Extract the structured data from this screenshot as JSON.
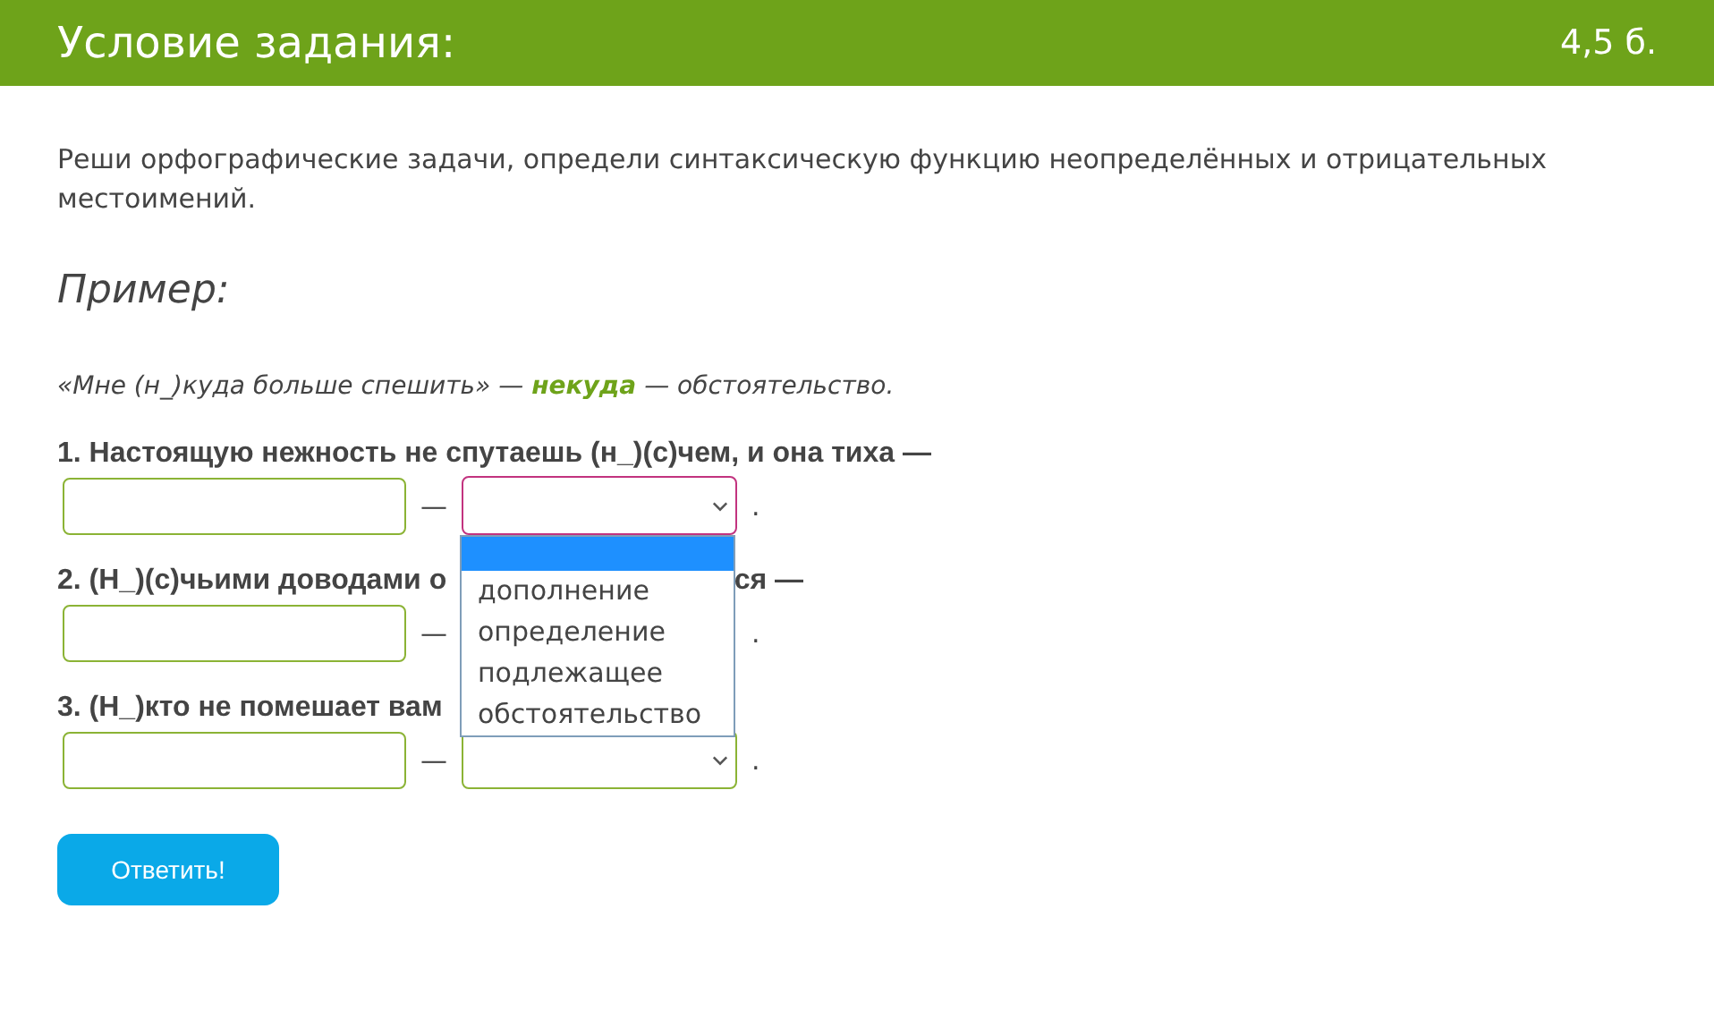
{
  "header": {
    "title": "Условие задания:",
    "points": "4,5 б."
  },
  "instruction": "Реши орфографические задачи, определи синтаксическую функцию неопределённых и отрицательных местоимений.",
  "example": {
    "heading": "Пример:",
    "text": "«Мне (н_)куда больше спешить» — **некуда** — обстоятельство."
  },
  "questions": [
    {
      "text": "1. Настоящую нежность не спутаешь (н_)(с)чем, и она тиха —",
      "select": {
        "focused": true
      }
    },
    {
      "text": "2. (Н_)(с)чьими доводами о",
      "tail": "ся —"
    },
    {
      "text": "3. (Н_)кто не помешает вам",
      "select": {
        "focused": false
      }
    }
  ],
  "dropdown": {
    "blank_highlighted": true,
    "options": [
      {
        "label": "дополнение",
        "selected": false
      },
      {
        "label": "определение",
        "selected": false
      },
      {
        "label": "подлежащее",
        "selected": false
      },
      {
        "label": "обстоятельство",
        "selected": false
      }
    ]
  },
  "dash": "—",
  "period": ".",
  "submit": "Ответить!"
}
